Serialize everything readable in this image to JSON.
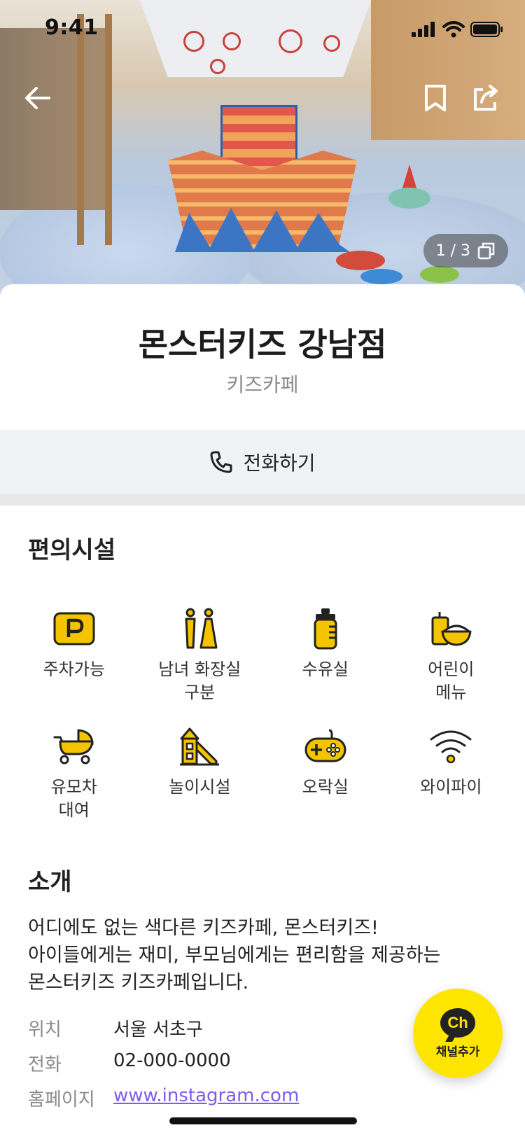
{
  "status_bar": {
    "time": "9:41"
  },
  "hero": {
    "photo_counter": "1 / 3"
  },
  "place": {
    "name": "몬스터키즈 강남점",
    "category": "키즈카페"
  },
  "call_button": {
    "label": "전화하기"
  },
  "amenities": {
    "title": "편의시설",
    "items": [
      {
        "icon": "parking-icon",
        "label": "주차가능"
      },
      {
        "icon": "restroom-icon",
        "label": "남녀 화장실\n구분"
      },
      {
        "icon": "baby-bottle-icon",
        "label": "수유실"
      },
      {
        "icon": "kids-meal-icon",
        "label": "어린이\n메뉴"
      },
      {
        "icon": "stroller-icon",
        "label": "유모차\n대여"
      },
      {
        "icon": "playground-icon",
        "label": "놀이시설"
      },
      {
        "icon": "gamepad-icon",
        "label": "오락실"
      },
      {
        "icon": "wifi-icon",
        "label": "와이파이"
      }
    ]
  },
  "intro": {
    "title": "소개",
    "lines": [
      "어디에도 없는 색다른 키즈카페, 몬스터키즈!",
      "아이들에게는 재미, 부모님에게는 편리함을 제공하는",
      "몬스터키즈 키즈카페입니다."
    ]
  },
  "info": {
    "location": {
      "key": "위치",
      "value": "서울 서초구"
    },
    "phone": {
      "key": "전화",
      "value": "02-000-0000"
    },
    "homepage": {
      "key": "홈페이지",
      "value": "www.instagram.com"
    }
  },
  "channel_button": {
    "label": "채널추가",
    "badge": "Ch"
  },
  "colors": {
    "accent": "#fee500",
    "icon_yellow": "#f5c400",
    "link": "#7b5cf0"
  }
}
